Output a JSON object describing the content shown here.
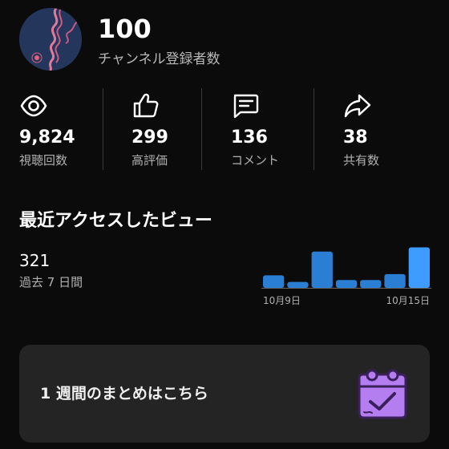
{
  "channel": {
    "subscriber_count": "100",
    "subscriber_label": "チャンネル登録者数",
    "avatar_icon": "channel-avatar"
  },
  "stats": [
    {
      "icon": "eye-icon",
      "value": "9,824",
      "label": "視聴回数"
    },
    {
      "icon": "thumbs-up-icon",
      "value": "299",
      "label": "高評価"
    },
    {
      "icon": "comment-icon",
      "value": "136",
      "label": "コメント"
    },
    {
      "icon": "share-icon",
      "value": "38",
      "label": "共有数"
    }
  ],
  "recent_views": {
    "title": "最近アクセスしたビュー",
    "count": "321",
    "period": "過去 7 日間"
  },
  "chart_data": {
    "type": "bar",
    "categories": [
      "10月9日",
      "",
      "",
      "",
      "",
      "",
      "10月15日"
    ],
    "values": [
      21,
      10,
      61,
      13,
      13,
      23,
      68
    ],
    "tick_labels": [
      "10月9日",
      "10月15日"
    ],
    "bar_color": "#2a7fd4",
    "highlight_color": "#3e9bff",
    "ylim": [
      0,
      70
    ]
  },
  "weekly_summary": {
    "label": "1 週間のまとめはこちら",
    "icon": "calendar-check-icon"
  },
  "colors": {
    "background": "#0b0b0b",
    "card": "#242424",
    "accent_purple": "#b47ef0"
  }
}
